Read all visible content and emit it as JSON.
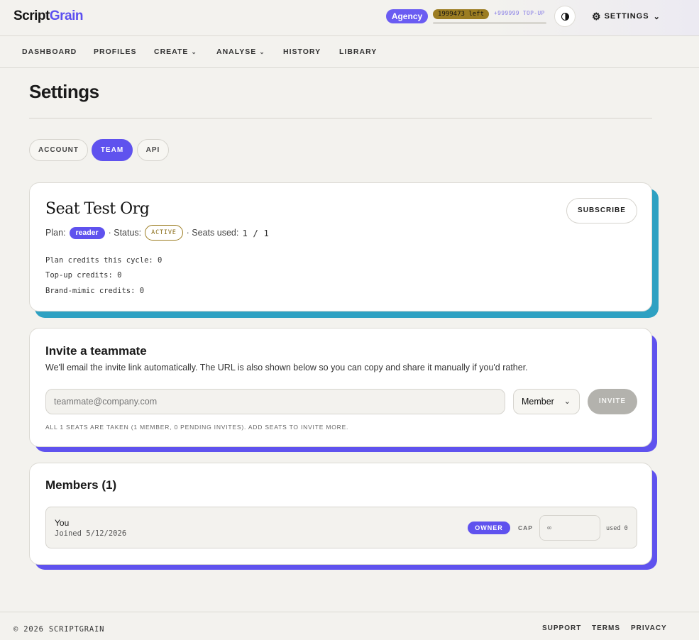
{
  "brand": {
    "part1": "Script",
    "part2": "Grain"
  },
  "header": {
    "plan_pill": "Agency",
    "credits_left": "1999473 left",
    "topup": "+999999 TOP-UP",
    "settings_label": "SETTINGS",
    "credits_fraction_used": 0.0
  },
  "nav": {
    "items": [
      {
        "label": "DASHBOARD"
      },
      {
        "label": "PROFILES"
      },
      {
        "label": "CREATE",
        "has_caret": true
      },
      {
        "label": "ANALYSE",
        "has_caret": true
      },
      {
        "label": "HISTORY"
      },
      {
        "label": "LIBRARY"
      }
    ]
  },
  "page": {
    "title": "Settings"
  },
  "tabs": [
    {
      "label": "ACCOUNT",
      "active": false
    },
    {
      "label": "TEAM",
      "active": true
    },
    {
      "label": "API",
      "active": false
    }
  ],
  "org": {
    "name": "Seat Test Org",
    "subscribe_label": "SUBSCRIBE",
    "plan_label": "Plan:",
    "plan_value": "reader",
    "status_label": "· Status:",
    "status_value": "ACTIVE",
    "seats_label": "· Seats used:",
    "seats_value": "1 / 1",
    "plan_credits": "Plan credits this cycle: 0",
    "topup_credits": "Top-up credits: 0",
    "brand_credits": "Brand-mimic credits: 0",
    "accent_color": "#2ea1c2"
  },
  "invite": {
    "title": "Invite a teammate",
    "description": "We'll email the invite link automatically. The URL is also shown below so you can copy and share it manually if you'd rather.",
    "email_placeholder": "teammate@company.com",
    "role_value": "Member",
    "button_label": "INVITE",
    "seat_note": "ALL 1 SEATS ARE TAKEN (1 MEMBER, 0 PENDING INVITES). ADD SEATS TO INVITE MORE.",
    "accent_color": "#5f52ee"
  },
  "members": {
    "title": "Members (1)",
    "rows": [
      {
        "name": "You",
        "joined": "Joined 5/12/2026",
        "role": "OWNER",
        "cap_label": "CAP",
        "cap_placeholder": "∞",
        "used": "used 0"
      }
    ]
  },
  "footer": {
    "copyright": "© 2026 SCRIPTGRAIN",
    "links": [
      {
        "label": "SUPPORT"
      },
      {
        "label": "TERMS"
      },
      {
        "label": "PRIVACY"
      }
    ]
  }
}
